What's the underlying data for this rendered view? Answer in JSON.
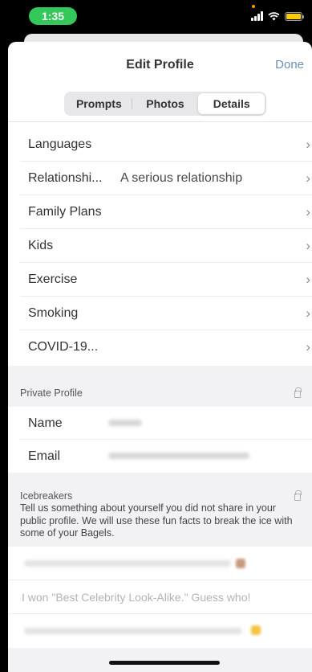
{
  "status": {
    "time": "1:35"
  },
  "header": {
    "title": "Edit Profile",
    "done_label": "Done"
  },
  "tabs": [
    {
      "label": "Prompts",
      "active": false
    },
    {
      "label": "Photos",
      "active": false
    },
    {
      "label": "Details",
      "active": true
    }
  ],
  "details": [
    {
      "label": "Languages",
      "value": ""
    },
    {
      "label": "Relationshi...",
      "value": "A serious relationship"
    },
    {
      "label": "Family Plans",
      "value": ""
    },
    {
      "label": "Kids",
      "value": ""
    },
    {
      "label": "Exercise",
      "value": ""
    },
    {
      "label": "Smoking",
      "value": ""
    },
    {
      "label": "COVID-19...",
      "value": ""
    }
  ],
  "private_profile": {
    "section_label": "Private Profile",
    "fields": [
      {
        "label": "Name"
      },
      {
        "label": "Email"
      }
    ]
  },
  "icebreakers": {
    "section_label": "Icebreakers",
    "description": "Tell us something about yourself you did not share in your public profile. We will use these fun facts to break the ice with some of your Bagels.",
    "placeholder": "I won \"Best Celebrity Look-Alike.\" Guess who!"
  },
  "colors": {
    "accent": "#6d8fb0",
    "time_pill": "#34c759",
    "section_bg": "#f2f2f4"
  },
  "chevron": "›"
}
